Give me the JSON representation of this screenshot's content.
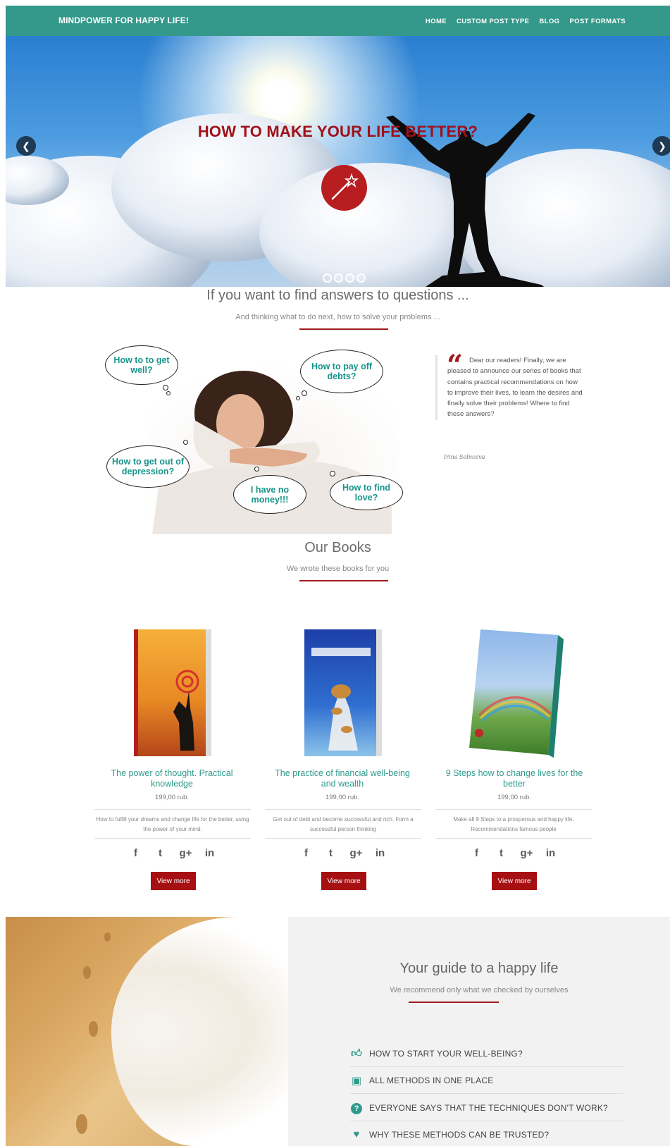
{
  "header": {
    "brand": "MINDPOWER FOR HAPPY LIFE!",
    "nav": [
      "HOME",
      "CUSTOM POST TYPE",
      "BLOG",
      "POST FORMATS"
    ],
    "color": "#34998a"
  },
  "hero": {
    "title": "HOW TO MAKE YOUR LIFE BETTER?",
    "prev_icon": "chevron-left-icon",
    "next_icon": "chevron-right-icon",
    "slides": 4,
    "active_slide": 1
  },
  "intro": {
    "title": "If you want to find answers to questions ...",
    "subtitle": "And thinking what to do next, how to solve your problems ...",
    "bubbles": [
      "How to to get well?",
      "How to pay off debts?",
      "How to get out of depression?",
      "I have no money!!!",
      "How to find love?"
    ],
    "quote": "Dear our readers! Finally, we are pleased to announce our series of books that contains practical recommendations on how to improve their lives, to learn the desires and finally solve their problems! Where to find these answers?",
    "author": "Irina Solnceva"
  },
  "books": {
    "title": "Our Books",
    "subtitle": "We wrote these books for you",
    "items": [
      {
        "title": "The power of thought. Practical knowledge",
        "price": "199,00 rub.",
        "desc": "How to fulfill your dreams and change life for the better, using the power of your mind.",
        "button": "View more"
      },
      {
        "title": "The practice of financial well-being and wealth",
        "price": "199,00 rub.",
        "desc": "Get out of debt and become successful and rich. Form a successful person thinking",
        "button": "View more"
      },
      {
        "title": "9 Steps how to change lives for the better",
        "price": "199,00 rub.",
        "desc": "Make all 9 Steps to a prosperous and happy life. Recommendations famous people",
        "button": "View more"
      }
    ],
    "social": [
      "f",
      "t",
      "g+",
      "in"
    ],
    "social_icons": [
      "facebook-icon",
      "twitter-icon",
      "google-plus-icon",
      "linkedin-icon"
    ]
  },
  "guide": {
    "title": "Your guide to a happy life",
    "subtitle": "We recommend only what we checked by ourselves",
    "faq": [
      {
        "icon": "thumbs-up-icon",
        "label": "HOW TO START YOUR WELL-BEING?"
      },
      {
        "icon": "gift-icon",
        "label": "ALL METHODS IN ONE PLACE"
      },
      {
        "icon": "question-circle-icon",
        "label": "EVERYONE SAYS THAT THE TECHNIQUES DON'T WORK?"
      },
      {
        "icon": "heart-icon",
        "label": "WHY THESE METHODS CAN BE TRUSTED?"
      }
    ]
  },
  "colors": {
    "accent": "#a01a1c",
    "teal": "#2f9a8c"
  }
}
